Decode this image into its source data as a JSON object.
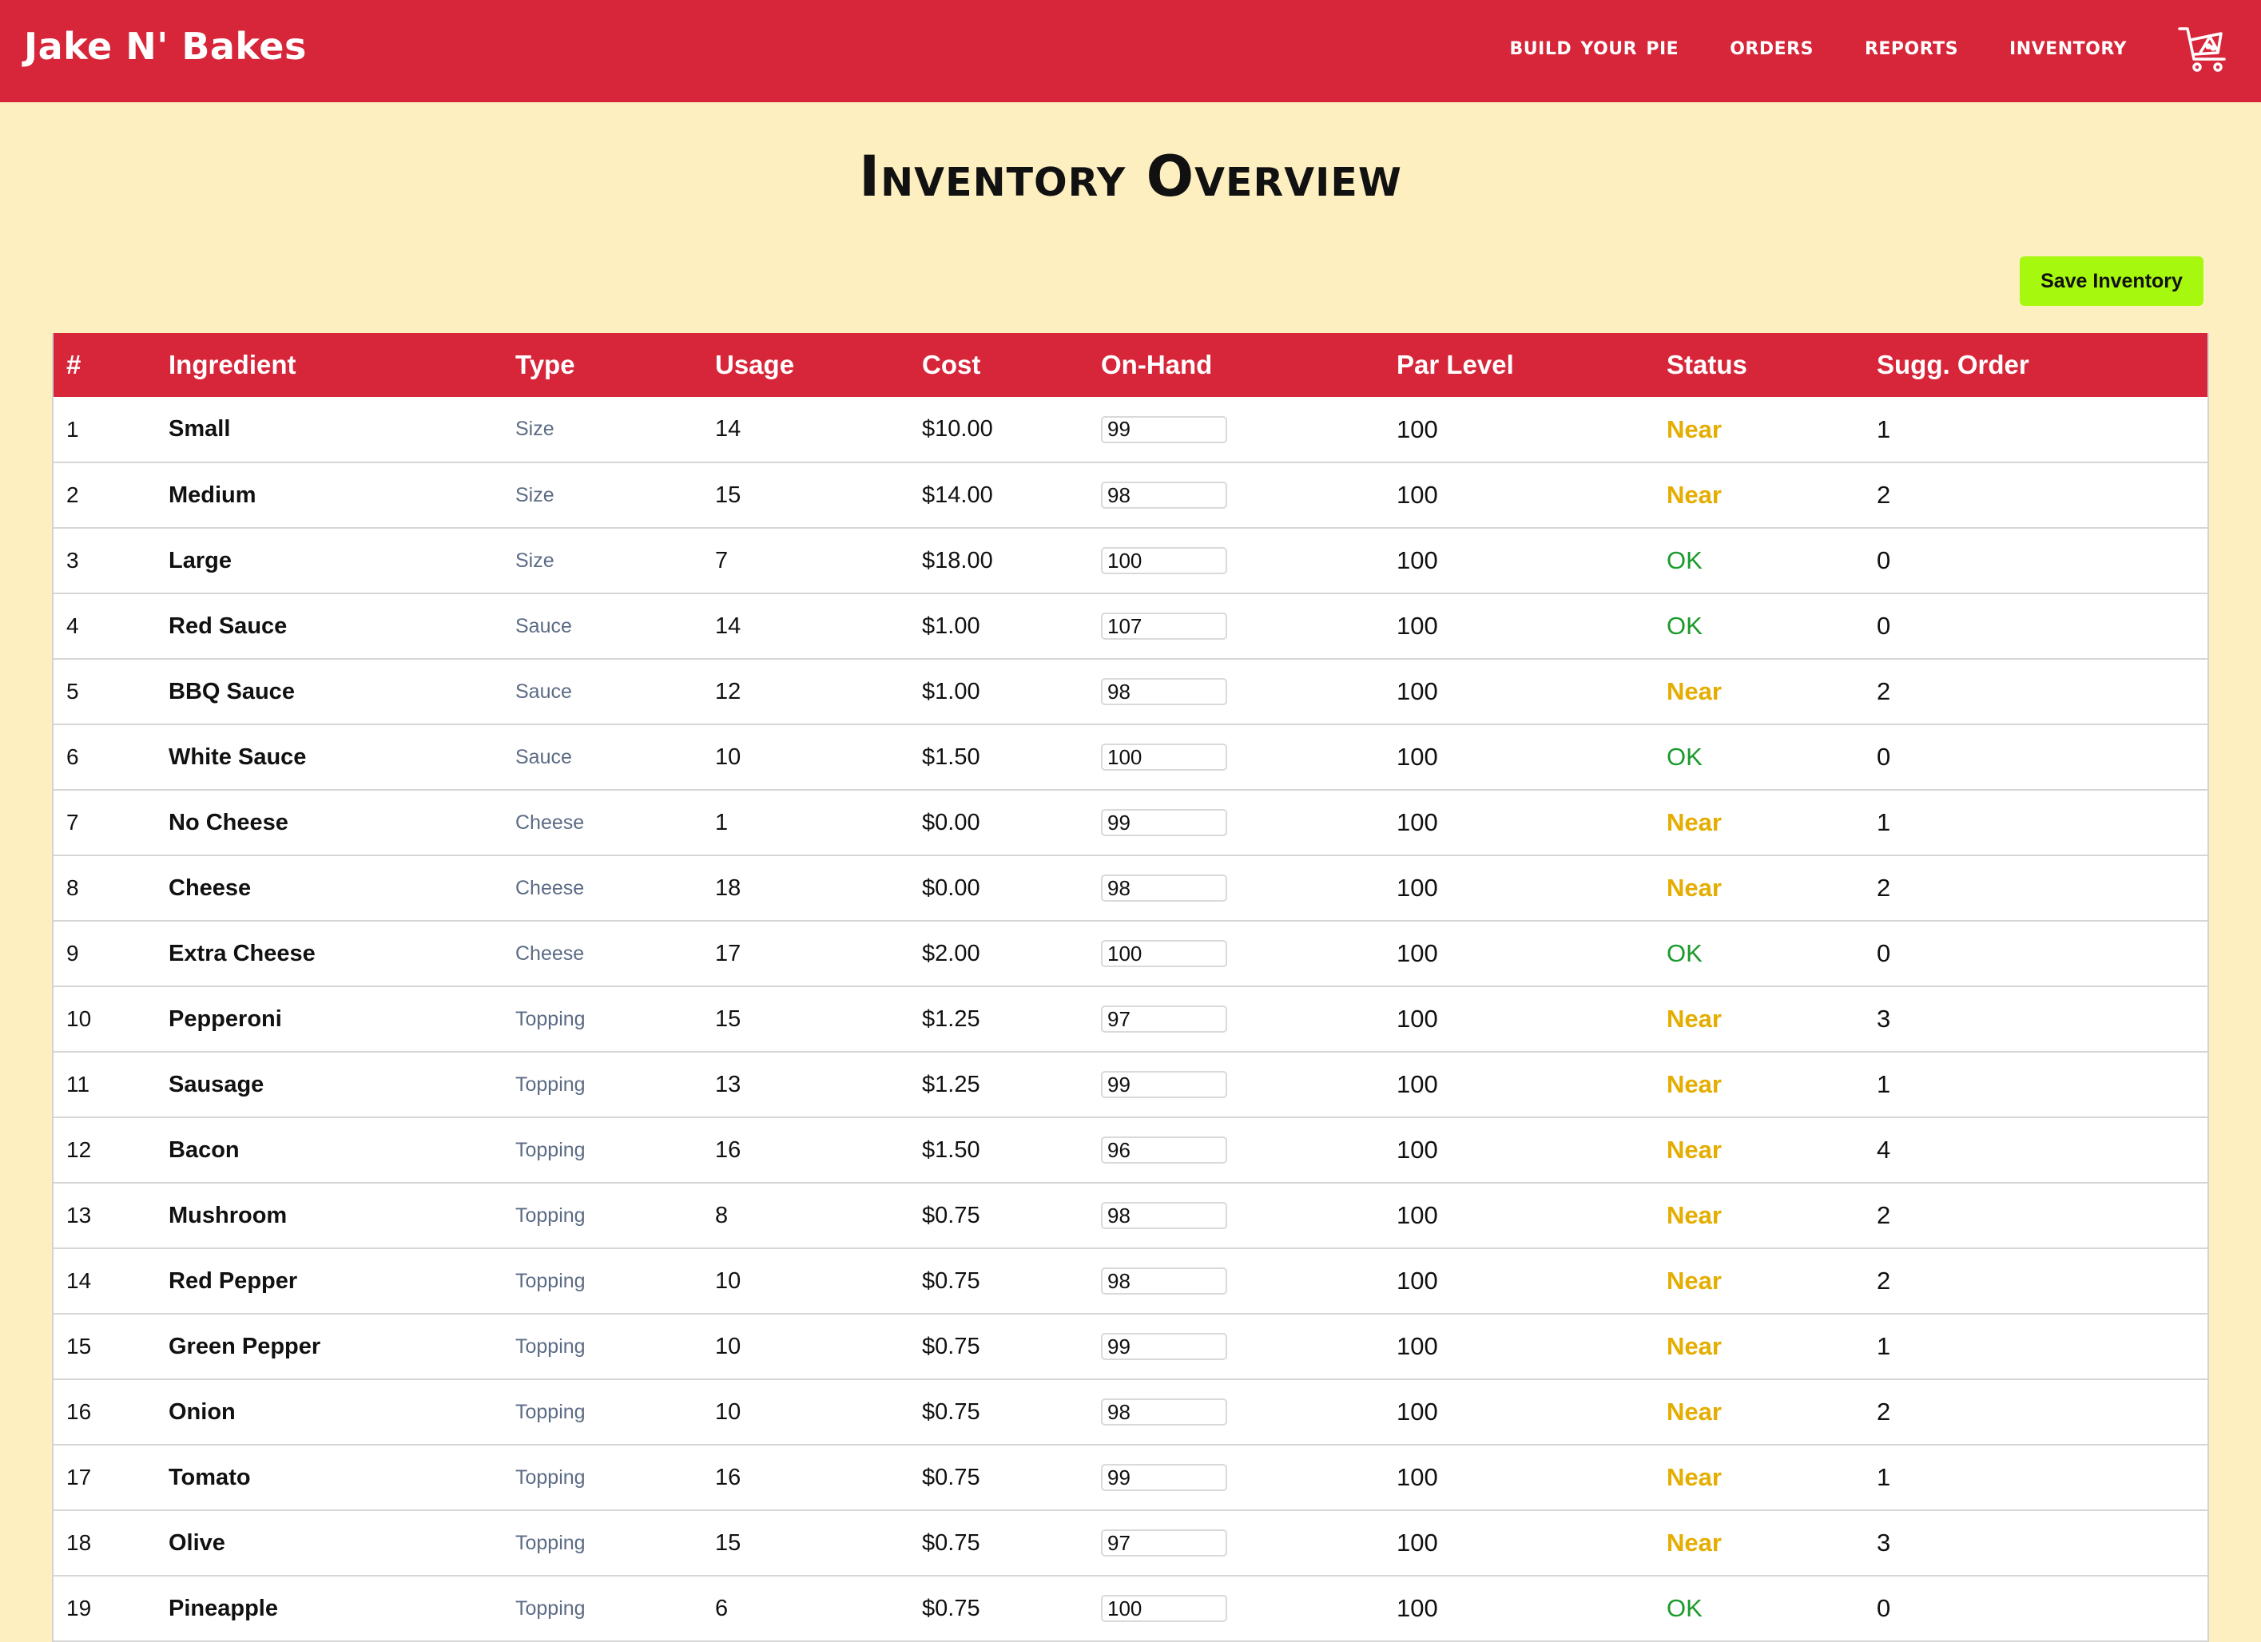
{
  "app": {
    "brand": "Jake N' Bakes",
    "accent_color": "#d7263a",
    "background_color": "#fdefc0"
  },
  "nav": {
    "items": [
      {
        "label": "Build Your Pie"
      },
      {
        "label": "Orders"
      },
      {
        "label": "Reports"
      },
      {
        "label": "Inventory"
      }
    ],
    "cart_icon": "pizza-cart-icon"
  },
  "page": {
    "title": "Inventory Overview",
    "save_label": "Save Inventory"
  },
  "table": {
    "columns": [
      "#",
      "Ingredient",
      "Type",
      "Usage",
      "Cost",
      "On-Hand",
      "Par Level",
      "Status",
      "Sugg. Order"
    ],
    "rows": [
      {
        "num": "1",
        "ingredient": "Small",
        "type": "Size",
        "usage": "14",
        "cost": "$10.00",
        "on_hand": "99",
        "par": "100",
        "status": "Near",
        "sugg": "1"
      },
      {
        "num": "2",
        "ingredient": "Medium",
        "type": "Size",
        "usage": "15",
        "cost": "$14.00",
        "on_hand": "98",
        "par": "100",
        "status": "Near",
        "sugg": "2"
      },
      {
        "num": "3",
        "ingredient": "Large",
        "type": "Size",
        "usage": "7",
        "cost": "$18.00",
        "on_hand": "100",
        "par": "100",
        "status": "OK",
        "sugg": "0"
      },
      {
        "num": "4",
        "ingredient": "Red Sauce",
        "type": "Sauce",
        "usage": "14",
        "cost": "$1.00",
        "on_hand": "107",
        "par": "100",
        "status": "OK",
        "sugg": "0"
      },
      {
        "num": "5",
        "ingredient": "BBQ Sauce",
        "type": "Sauce",
        "usage": "12",
        "cost": "$1.00",
        "on_hand": "98",
        "par": "100",
        "status": "Near",
        "sugg": "2"
      },
      {
        "num": "6",
        "ingredient": "White Sauce",
        "type": "Sauce",
        "usage": "10",
        "cost": "$1.50",
        "on_hand": "100",
        "par": "100",
        "status": "OK",
        "sugg": "0"
      },
      {
        "num": "7",
        "ingredient": "No Cheese",
        "type": "Cheese",
        "usage": "1",
        "cost": "$0.00",
        "on_hand": "99",
        "par": "100",
        "status": "Near",
        "sugg": "1"
      },
      {
        "num": "8",
        "ingredient": "Cheese",
        "type": "Cheese",
        "usage": "18",
        "cost": "$0.00",
        "on_hand": "98",
        "par": "100",
        "status": "Near",
        "sugg": "2"
      },
      {
        "num": "9",
        "ingredient": "Extra Cheese",
        "type": "Cheese",
        "usage": "17",
        "cost": "$2.00",
        "on_hand": "100",
        "par": "100",
        "status": "OK",
        "sugg": "0"
      },
      {
        "num": "10",
        "ingredient": "Pepperoni",
        "type": "Topping",
        "usage": "15",
        "cost": "$1.25",
        "on_hand": "97",
        "par": "100",
        "status": "Near",
        "sugg": "3"
      },
      {
        "num": "11",
        "ingredient": "Sausage",
        "type": "Topping",
        "usage": "13",
        "cost": "$1.25",
        "on_hand": "99",
        "par": "100",
        "status": "Near",
        "sugg": "1"
      },
      {
        "num": "12",
        "ingredient": "Bacon",
        "type": "Topping",
        "usage": "16",
        "cost": "$1.50",
        "on_hand": "96",
        "par": "100",
        "status": "Near",
        "sugg": "4"
      },
      {
        "num": "13",
        "ingredient": "Mushroom",
        "type": "Topping",
        "usage": "8",
        "cost": "$0.75",
        "on_hand": "98",
        "par": "100",
        "status": "Near",
        "sugg": "2"
      },
      {
        "num": "14",
        "ingredient": "Red Pepper",
        "type": "Topping",
        "usage": "10",
        "cost": "$0.75",
        "on_hand": "98",
        "par": "100",
        "status": "Near",
        "sugg": "2"
      },
      {
        "num": "15",
        "ingredient": "Green Pepper",
        "type": "Topping",
        "usage": "10",
        "cost": "$0.75",
        "on_hand": "99",
        "par": "100",
        "status": "Near",
        "sugg": "1"
      },
      {
        "num": "16",
        "ingredient": "Onion",
        "type": "Topping",
        "usage": "10",
        "cost": "$0.75",
        "on_hand": "98",
        "par": "100",
        "status": "Near",
        "sugg": "2"
      },
      {
        "num": "17",
        "ingredient": "Tomato",
        "type": "Topping",
        "usage": "16",
        "cost": "$0.75",
        "on_hand": "99",
        "par": "100",
        "status": "Near",
        "sugg": "1"
      },
      {
        "num": "18",
        "ingredient": "Olive",
        "type": "Topping",
        "usage": "15",
        "cost": "$0.75",
        "on_hand": "97",
        "par": "100",
        "status": "Near",
        "sugg": "3"
      },
      {
        "num": "19",
        "ingredient": "Pineapple",
        "type": "Topping",
        "usage": "6",
        "cost": "$0.75",
        "on_hand": "100",
        "par": "100",
        "status": "OK",
        "sugg": "0"
      }
    ]
  }
}
